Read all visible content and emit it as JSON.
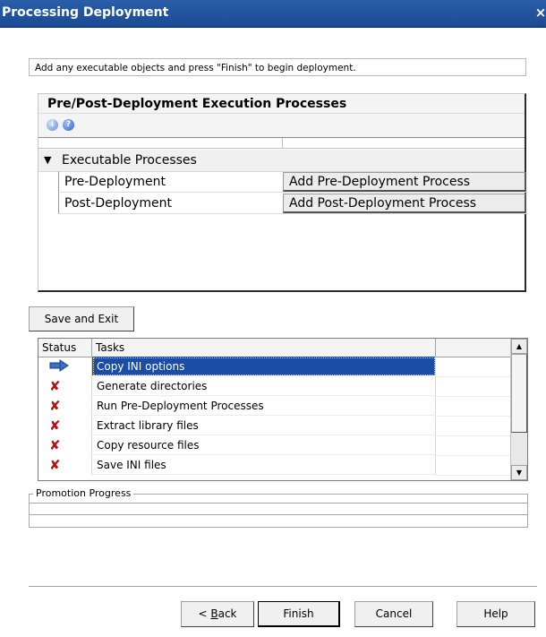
{
  "window": {
    "title": "Processing Deployment",
    "close_glyph": "×"
  },
  "instruction": "Add any executable objects and press \"Finish\" to begin deployment.",
  "property_panel": {
    "title": "Pre/Post-Deployment Execution Processes",
    "icons": [
      "info-icon",
      "help-icon"
    ],
    "category": "Executable Processes",
    "rows": [
      {
        "name": "Pre-Deployment",
        "value": "Add Pre-Deployment Process"
      },
      {
        "name": "Post-Deployment",
        "value": "Add Post-Deployment Process"
      }
    ]
  },
  "save_exit_label": "Save and Exit",
  "tasks": {
    "columns": [
      "Status",
      "Tasks",
      ""
    ],
    "rows": [
      {
        "status": "in-progress-arrow-icon",
        "task": "Copy INI options",
        "selected": true
      },
      {
        "status": "failed-x-icon",
        "task": "Generate directories"
      },
      {
        "status": "failed-x-icon",
        "task": "Run Pre-Deployment Processes"
      },
      {
        "status": "failed-x-icon",
        "task": "Extract library files"
      },
      {
        "status": "failed-x-icon",
        "task": "Copy resource files"
      },
      {
        "status": "failed-x-icon",
        "task": "Save INI files"
      }
    ]
  },
  "progress": {
    "label": "Promotion Progress"
  },
  "buttons": {
    "back_prefix": "< ",
    "back_mnemonic": "B",
    "back_rest": "ack",
    "finish": "Finish",
    "cancel": "Cancel",
    "help": "Help"
  },
  "colors": {
    "titlebar": "#1b4a94",
    "selection": "#1b4da6",
    "failed": "#b31212"
  }
}
